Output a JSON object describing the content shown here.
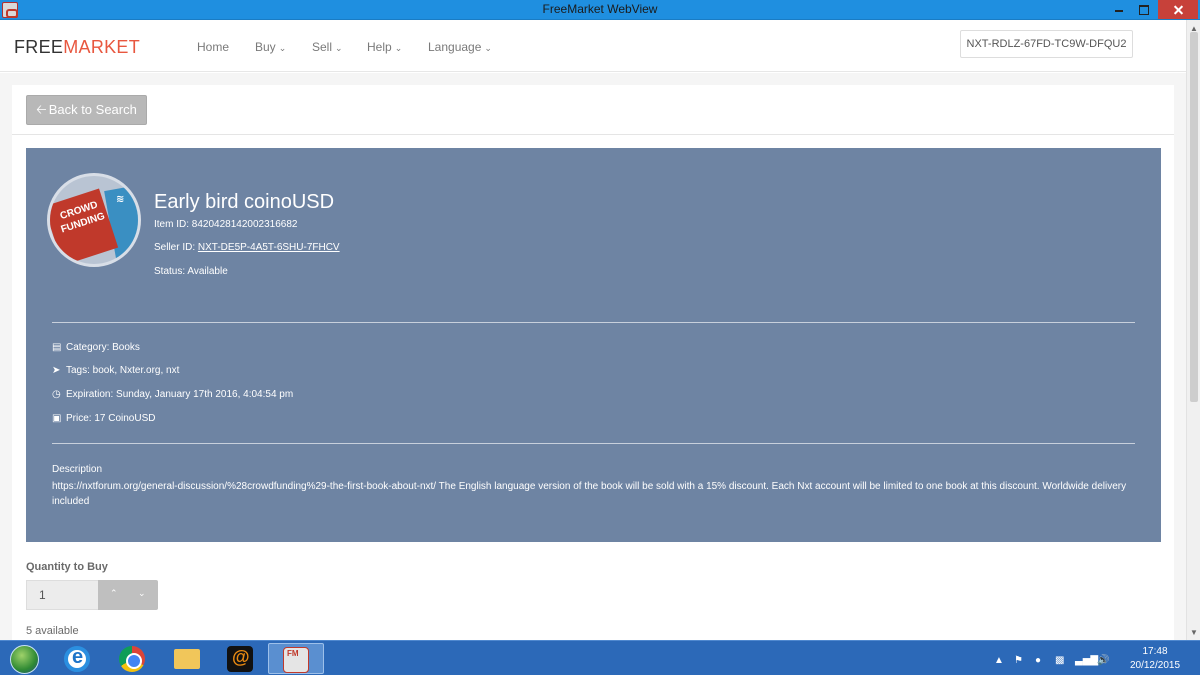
{
  "window": {
    "title": "FreeMarket WebView"
  },
  "navbar": {
    "brand_part1": "FREE",
    "brand_part2": "MARKET",
    "items": [
      {
        "label": "Home",
        "dropdown": false
      },
      {
        "label": "Buy",
        "dropdown": true
      },
      {
        "label": "Sell",
        "dropdown": true
      },
      {
        "label": "Help",
        "dropdown": true
      },
      {
        "label": "Language",
        "dropdown": true
      }
    ],
    "account_id": "NXT-RDLZ-67FD-TC9W-DFQU2"
  },
  "back_button": {
    "label": "Back to Search"
  },
  "item": {
    "title": "Early bird coinoUSD",
    "item_id": "Item ID: 8420428142002316682",
    "seller_label": "Seller ID: ",
    "seller_id": "NXT-DE5P-4A5T-6SHU-7FHCV",
    "status": "Status: Available",
    "image_sign_text": "CROWD FUNDING",
    "category": "Category: Books",
    "tags": "Tags: book, Nxter.org, nxt",
    "expiration": "Expiration: Sunday, January 17th 2016, 4:04:54 pm",
    "price": "Price: 17 CoinoUSD",
    "description_label": "Description",
    "description": "https://nxtforum.org/general-discussion/%28crowdfunding%29-the-first-book-about-nxt/ The English language version of the book will be sold with a 15% discount. Each Nxt account will be limited to one book at this discount. Worldwide delivery included"
  },
  "purchase": {
    "quantity_label": "Quantity to Buy",
    "quantity_value": "1",
    "available": "5 available"
  },
  "taskbar": {
    "apps": [
      "start-orb",
      "internet-explorer",
      "chrome",
      "file-explorer",
      "spiral-app",
      "freemarket-app"
    ],
    "clock_time": "17:48",
    "clock_date": "20/12/2015"
  },
  "colors": {
    "titlebar": "#1f8fe0",
    "brand_accent": "#e8573f",
    "card": "#6e84a3",
    "taskbar": "#2c69b8",
    "close_button": "#c7413a"
  }
}
